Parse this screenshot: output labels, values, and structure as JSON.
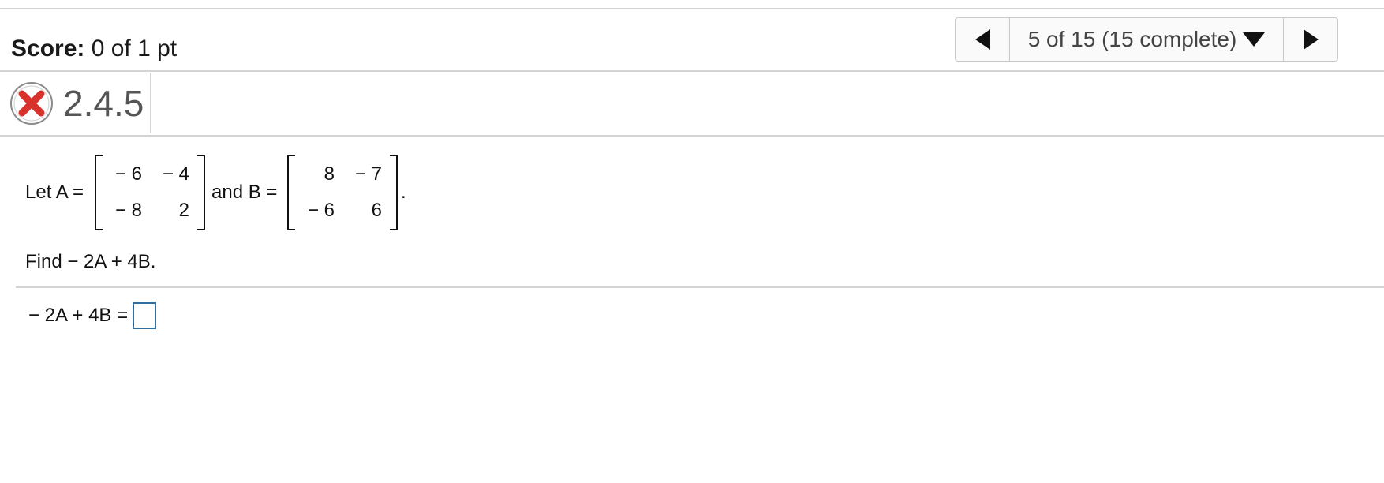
{
  "score": {
    "label": "Score:",
    "value": "0 of 1 pt"
  },
  "navigator": {
    "status": "5 of 15 (15 complete)",
    "prev_icon": "triangle-left",
    "next_icon": "triangle-right",
    "dropdown_icon": "triangle-down"
  },
  "question": {
    "status_icon": "incorrect-x",
    "status_color": "#d9312b",
    "number": "2.4.5"
  },
  "problem": {
    "let_text": "Let A =",
    "and_text": "and B =",
    "period": ".",
    "matrix_a": [
      [
        "− 6",
        "− 4"
      ],
      [
        "− 8",
        "2"
      ]
    ],
    "matrix_b": [
      [
        "8",
        "− 7"
      ],
      [
        "− 6",
        "6"
      ]
    ],
    "find_text": "Find  − 2A + 4B.",
    "answer_label": "− 2A + 4B =",
    "answer_value": ""
  },
  "colors": {
    "rule": "#d3d3d3",
    "answer_box_border": "#2f6e9e"
  }
}
